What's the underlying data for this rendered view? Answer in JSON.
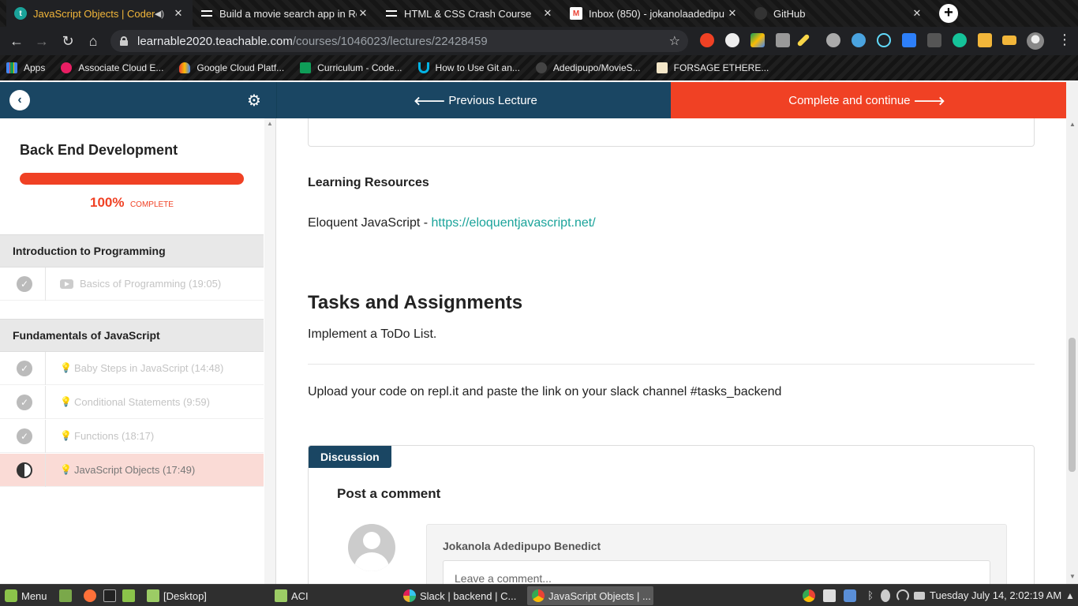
{
  "browser": {
    "tabs": [
      {
        "title": "JavaScript Objects | Coder",
        "active": true,
        "audio": true,
        "favicon_color": "#1aa39a",
        "favicon_letter": "t"
      },
      {
        "title": "Build a movie search app in Re",
        "favicon_color": "#ffffff"
      },
      {
        "title": "HTML & CSS Crash Course",
        "favicon_color": "#ffffff"
      },
      {
        "title": "Inbox (850) - jokanolaadedipu",
        "favicon_color": "#ea4335",
        "favicon_letter": "M"
      },
      {
        "title": "GitHub",
        "favicon_color": "#333333"
      }
    ],
    "url_host": "learnable2020.teachable.com",
    "url_path": "/courses/1046023/lectures/22428459",
    "bookmarks": [
      {
        "label": "Apps",
        "icon": "apps-grid-icon",
        "color": "#4285f4"
      },
      {
        "label": "Associate Cloud E...",
        "icon": "cloud-cert-icon",
        "color": "#e91e63"
      },
      {
        "label": "Google Cloud Platf...",
        "icon": "google-cloud-icon",
        "color": "#4285f4"
      },
      {
        "label": "Curriculum - Code...",
        "icon": "sheets-icon",
        "color": "#0f9d58"
      },
      {
        "label": "How to Use Git an...",
        "icon": "udacity-icon",
        "color": "#02b3e4"
      },
      {
        "label": "Adedipupo/MovieS...",
        "icon": "github-icon",
        "color": "#444444"
      },
      {
        "label": "FORSAGE ETHERE...",
        "icon": "forsage-icon",
        "color": "#f3e6c8"
      }
    ]
  },
  "course": {
    "prev_label": "Previous Lecture",
    "next_label": "Complete and continue",
    "title": "Back End Development",
    "progress_pct": "100%",
    "progress_label": "COMPLETE",
    "progress_value": 1.0,
    "sections": [
      {
        "title": "Introduction to Programming",
        "lectures": [
          {
            "title": "Basics of Programming (19:05)",
            "type": "video",
            "status": "complete"
          }
        ]
      },
      {
        "title": "Fundamentals of JavaScript",
        "lectures": [
          {
            "title": "Baby Steps in JavaScript (14:48)",
            "type": "text",
            "status": "complete"
          },
          {
            "title": "Conditional Statements (9:59)",
            "type": "text",
            "status": "complete"
          },
          {
            "title": "Functions (18:17)",
            "type": "text",
            "status": "complete"
          },
          {
            "title": "JavaScript Objects (17:49)",
            "type": "text",
            "status": "current"
          }
        ]
      }
    ]
  },
  "content": {
    "resources_heading": "Learning Resources",
    "resource_text": "Eloquent JavaScript - ",
    "resource_link": "https://eloquentjavascript.net/",
    "tasks_heading": "Tasks and Assignments",
    "task_1": "Implement a ToDo List.",
    "task_2": "Upload your code on repl.it and paste the link on your slack channel #tasks_backend"
  },
  "discussion": {
    "tag": "Discussion",
    "post_title": "Post a comment",
    "author": "Jokanola Adedipupo Benedict",
    "placeholder": "Leave a comment..."
  },
  "taskbar": {
    "menu_label": "Menu",
    "windows": [
      {
        "label": "[Desktop]",
        "icon": "folder-icon"
      },
      {
        "label": "ACI",
        "icon": "folder-icon"
      },
      {
        "label": "Slack | backend | C...",
        "icon": "slack-icon"
      },
      {
        "label": "JavaScript Objects | ...",
        "icon": "chrome-icon",
        "active": true
      }
    ],
    "clock": "Tuesday July 14,  2:02:19 AM"
  },
  "colors": {
    "navy": "#1a4663",
    "accent": "#f04124",
    "link": "#1aa39a"
  }
}
